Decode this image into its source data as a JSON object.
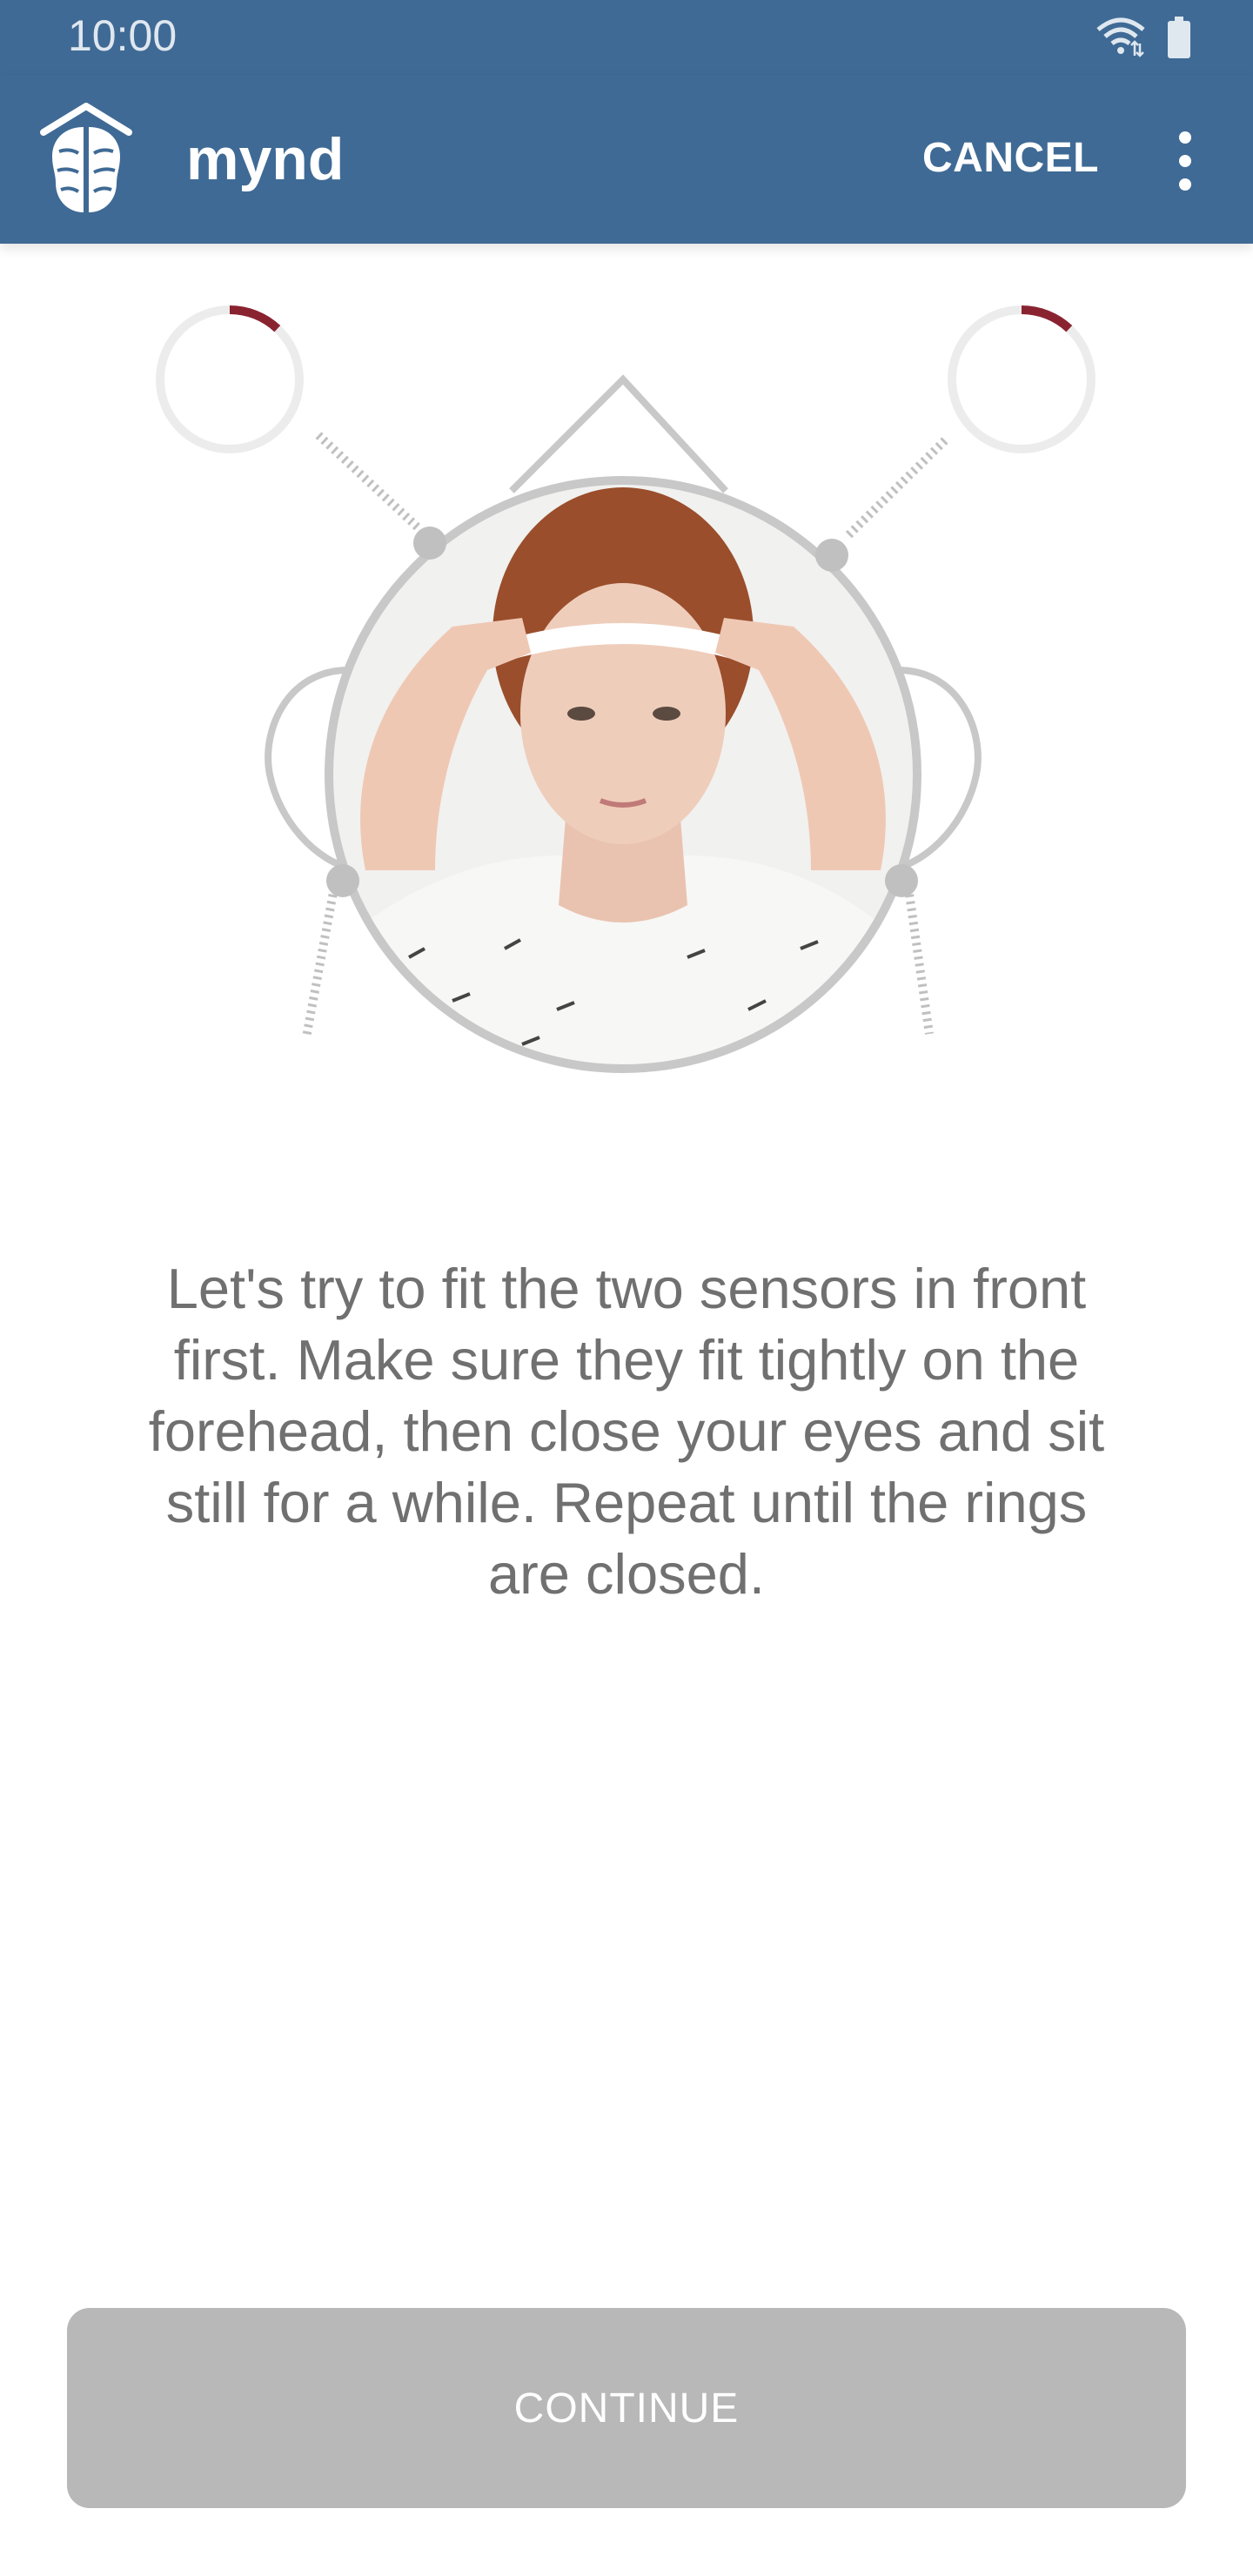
{
  "status_bar": {
    "time": "10:00",
    "icons": [
      "wifi-icon",
      "battery-icon"
    ]
  },
  "app_bar": {
    "title": "mynd",
    "logo": "brain-house-logo",
    "cancel_label": "CANCEL",
    "overflow_icon": "more-vert-icon"
  },
  "sensors": {
    "left_progress_fraction": 0.12,
    "right_progress_fraction": 0.12,
    "progress_color": "#8a2330",
    "ring_color": "#ececec"
  },
  "instructions": "Let's try to fit the two sensors in front first. Make sure they fit tightly on the forehead, then close your eyes and sit still for a while. Repeat until the rings are closed.",
  "continue_label": "CONTINUE",
  "colors": {
    "primary": "#3f6a95",
    "button_disabled": "#b8b8b8",
    "text": "#707070"
  }
}
